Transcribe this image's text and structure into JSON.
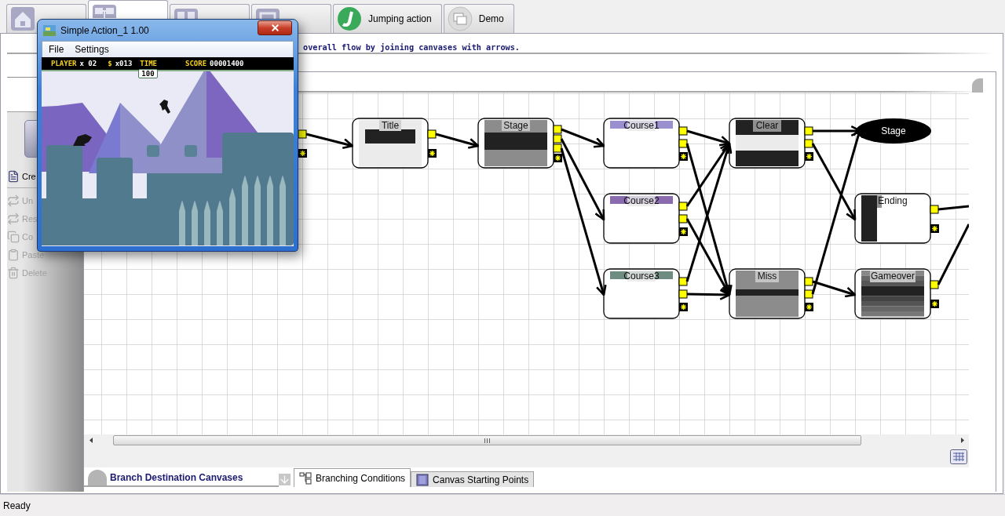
{
  "tabs": [
    {
      "selected": false
    },
    {
      "selected": true
    },
    {
      "selected": false
    },
    {
      "selected": false
    },
    {
      "label": "Jumping action",
      "selected": false
    },
    {
      "label": "Demo",
      "selected": false
    }
  ],
  "instruction": "overall flow by joining canvases with arrows.",
  "sidebar": {
    "items": [
      {
        "label": "Cre",
        "disabled": false
      },
      {
        "label": "Un",
        "disabled": true
      },
      {
        "label": "Res",
        "disabled": true
      },
      {
        "label": "Co",
        "disabled": true
      },
      {
        "label": "Paste",
        "disabled": true
      },
      {
        "label": "Delete",
        "disabled": true
      }
    ]
  },
  "flow": {
    "nodes": [
      {
        "label": "Title",
        "kind": "title"
      },
      {
        "label": "Stage",
        "kind": "stage"
      },
      {
        "label": "Course1",
        "kind": "course",
        "color": "#9c8fd0"
      },
      {
        "label": "Clear",
        "kind": "clear"
      },
      {
        "label": "Stage",
        "kind": "terminal"
      },
      {
        "label": "Course2",
        "kind": "course",
        "color": "#8a6cae"
      },
      {
        "label": "Ending",
        "kind": "ending"
      },
      {
        "label": "Course3",
        "kind": "course",
        "color": "#6f8c80"
      },
      {
        "label": "Miss",
        "kind": "miss"
      },
      {
        "label": "Gameover",
        "kind": "gameover"
      }
    ]
  },
  "bottom_panel": {
    "title": "Branch Destination Canvases",
    "tabs": [
      {
        "label": "Branching Conditions",
        "selected": true
      },
      {
        "label": "Canvas Starting Points",
        "selected": false
      }
    ]
  },
  "status_bar": "Ready",
  "game_window": {
    "title": "Simple Action_1 1.00",
    "menu": [
      "File",
      "Settings"
    ],
    "hud": [
      {
        "label": "PLAYER",
        "value": "x 02",
        "kind": "inline"
      },
      {
        "label": "$",
        "value": "x013",
        "kind": "inline"
      },
      {
        "label": "TIME",
        "value": "100",
        "kind": "boxed"
      },
      {
        "label": "SCORE",
        "value": "00001400",
        "kind": "inline"
      }
    ]
  }
}
